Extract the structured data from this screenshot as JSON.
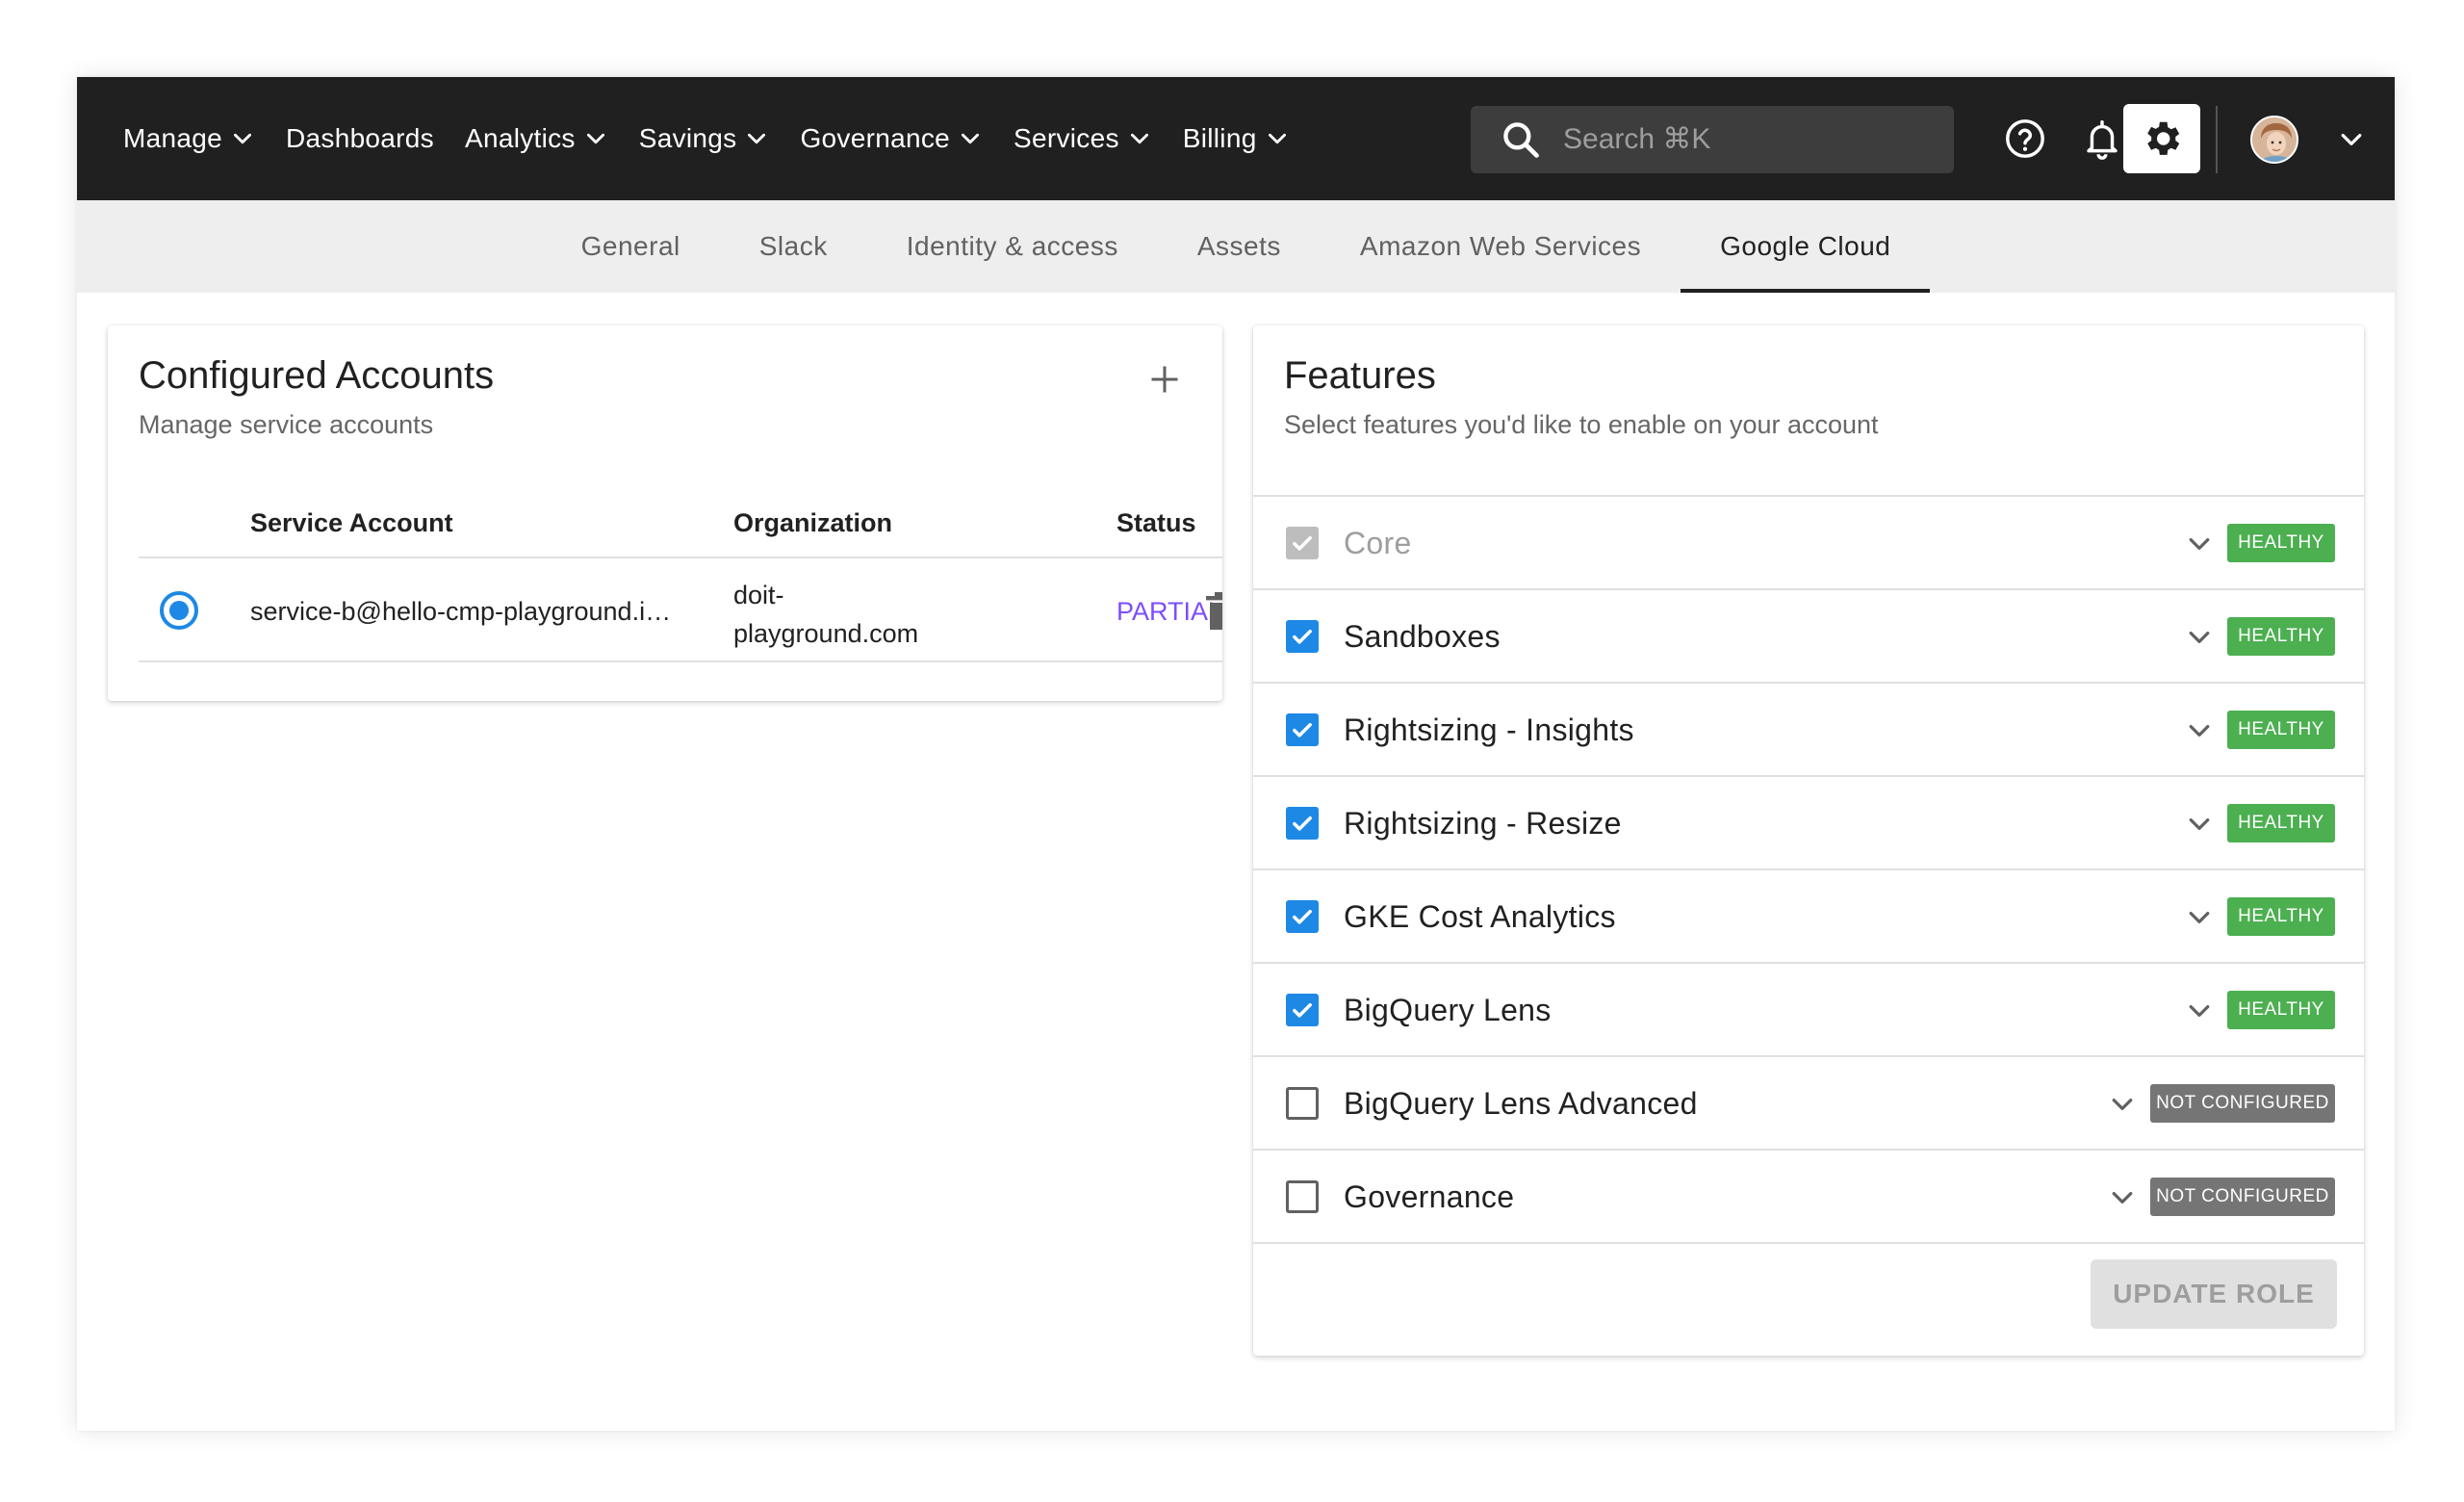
{
  "topnav": {
    "items": [
      {
        "label": "Manage",
        "has_dropdown": true
      },
      {
        "label": "Dashboards",
        "has_dropdown": false
      },
      {
        "label": "Analytics",
        "has_dropdown": true
      },
      {
        "label": "Savings",
        "has_dropdown": true
      },
      {
        "label": "Governance",
        "has_dropdown": true
      },
      {
        "label": "Services",
        "has_dropdown": true
      },
      {
        "label": "Billing",
        "has_dropdown": true
      }
    ],
    "search_placeholder": "Search ⌘K",
    "icons": [
      "help-circle-icon",
      "bell-icon",
      "gear-icon",
      "avatar",
      "chevron-down-icon"
    ]
  },
  "tabs": [
    {
      "label": "General",
      "active": false
    },
    {
      "label": "Slack",
      "active": false
    },
    {
      "label": "Identity & access",
      "active": false
    },
    {
      "label": "Assets",
      "active": false
    },
    {
      "label": "Amazon Web Services",
      "active": false
    },
    {
      "label": "Google Cloud",
      "active": true
    }
  ],
  "accounts_card": {
    "title": "Configured Accounts",
    "subtitle": "Manage service accounts",
    "columns": [
      "Service Account",
      "Organization",
      "Status"
    ],
    "rows": [
      {
        "service_account": "service-b@hello-cmp-playground.iam.gserviceaccount.com",
        "organization": "doit-playground.com",
        "status": "PARTIAL",
        "selected": true
      }
    ]
  },
  "features_card": {
    "title": "Features",
    "subtitle": "Select features you'd like to enable on your account",
    "features": [
      {
        "label": "Core",
        "state": "disabled",
        "status": "HEALTHY"
      },
      {
        "label": "Sandboxes",
        "state": "checked",
        "status": "HEALTHY"
      },
      {
        "label": "Rightsizing - Insights",
        "state": "checked",
        "status": "HEALTHY"
      },
      {
        "label": "Rightsizing - Resize",
        "state": "checked",
        "status": "HEALTHY"
      },
      {
        "label": "GKE Cost Analytics",
        "state": "checked",
        "status": "HEALTHY"
      },
      {
        "label": "BigQuery Lens",
        "state": "checked",
        "status": "HEALTHY"
      },
      {
        "label": "BigQuery Lens Advanced",
        "state": "unchecked",
        "status": "NOT CONFIGURED"
      },
      {
        "label": "Governance",
        "state": "unchecked",
        "status": "NOT CONFIGURED"
      }
    ],
    "update_button": "UPDATE ROLE"
  },
  "colors": {
    "topbar": "#202020",
    "accent_blue": "#1e88e5",
    "healthy_green": "#4caf50",
    "not_configured_grey": "#757575",
    "partial_purple": "#7c4dff"
  }
}
